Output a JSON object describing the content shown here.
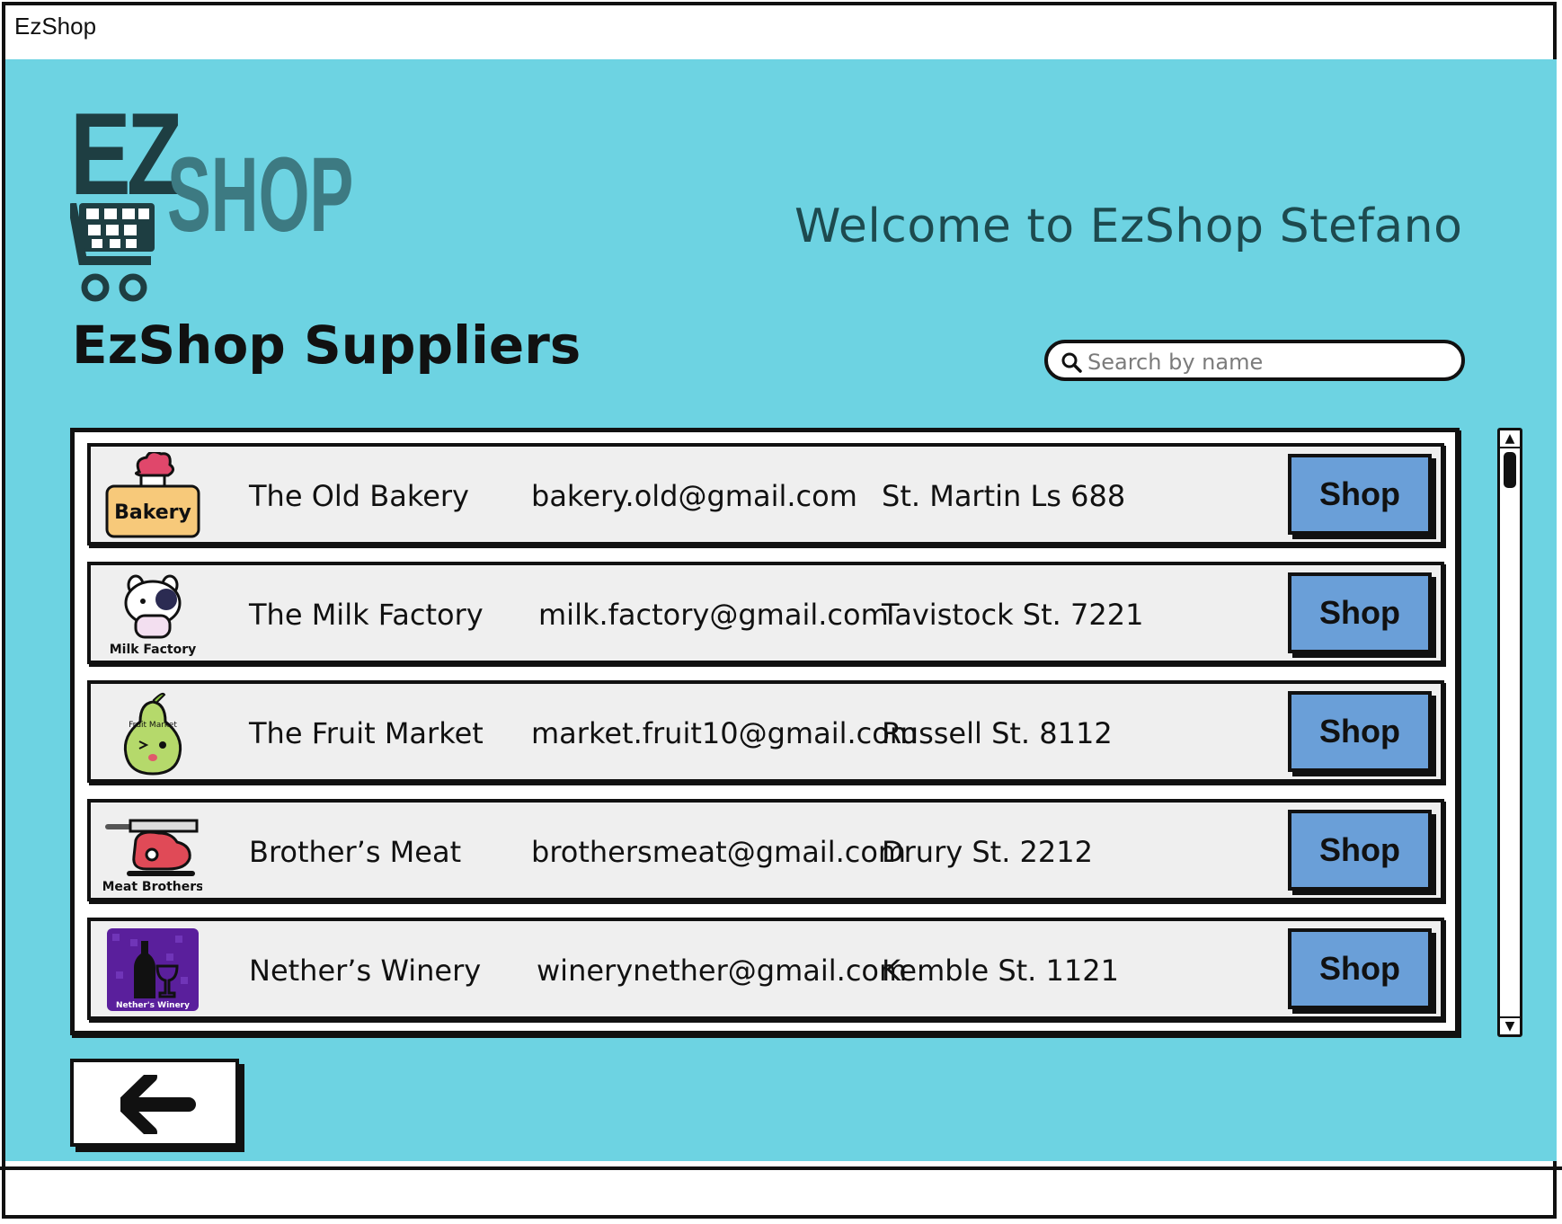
{
  "window": {
    "title": "EzShop"
  },
  "header": {
    "logo_text_ez": "EZ",
    "logo_text_shop": "SHOP",
    "welcome": "Welcome to EzShop Stefano"
  },
  "page": {
    "title": "EzShop Suppliers"
  },
  "search": {
    "placeholder": "Search by name",
    "value": "",
    "icon": "search-icon"
  },
  "suppliers": [
    {
      "name": "The Old Bakery",
      "email": "bakery.old@gmail.com",
      "address": "St. Martin Ls 688",
      "button": "Shop",
      "logo_label": "Bakery",
      "icon": "bakery-logo-icon"
    },
    {
      "name": "The Milk Factory",
      "email": "milk.factory@gmail.com",
      "address": "Tavistock St. 7221",
      "button": "Shop",
      "logo_label": "Milk Factory",
      "icon": "cow-logo-icon"
    },
    {
      "name": "The Fruit Market",
      "email": "market.fruit10@gmail.com",
      "address": "Russell St. 8112",
      "button": "Shop",
      "logo_label": "Fruit Market",
      "icon": "pear-logo-icon"
    },
    {
      "name": "Brother’s Meat",
      "email": "brothersmeat@gmail.com",
      "address": "Drury St. 2212",
      "button": "Shop",
      "logo_label": "Meat Brothers",
      "icon": "meat-logo-icon"
    },
    {
      "name": "Nether’s Winery",
      "email": "winerynether@gmail.com",
      "address": "Kemble St. 1121",
      "button": "Shop",
      "logo_label": "Nether's Winery",
      "icon": "wine-logo-icon"
    }
  ],
  "navigation": {
    "back_icon": "arrow-left-icon"
  },
  "colors": {
    "background": "#6dd3e2",
    "button": "#6a9fd8",
    "row": "#efefef",
    "heading": "#1d4a4f"
  }
}
